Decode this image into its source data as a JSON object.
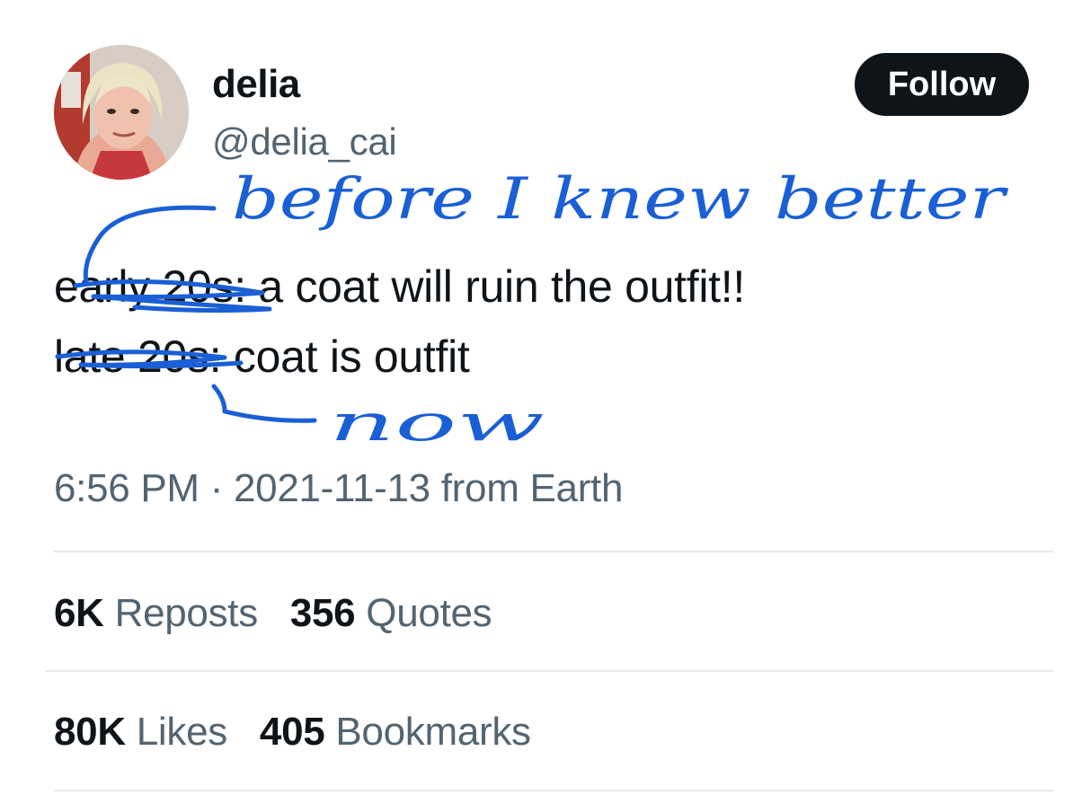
{
  "author": {
    "display_name": "delia",
    "handle": "@delia_cai",
    "avatar_icon": "profile-photo"
  },
  "follow_button": {
    "label": "Follow"
  },
  "tweet": {
    "line1": {
      "prefix": "early 20s",
      "text": ": a coat will ruin the outfit!!"
    },
    "line2": {
      "prefix": "late 20s",
      "text": ": coat is outfit"
    }
  },
  "handwritten_annotations": {
    "above": "before I knew better",
    "below": "now",
    "ink_color": "#1a5fd6"
  },
  "meta": {
    "time": "6:56 PM",
    "separator": "·",
    "date": "2021-11-13",
    "source": "from Earth"
  },
  "stats": {
    "reposts": {
      "count": "6K",
      "label": "Reposts"
    },
    "quotes": {
      "count": "356",
      "label": "Quotes"
    },
    "likes": {
      "count": "80K",
      "label": "Likes"
    },
    "bookmarks": {
      "count": "405",
      "label": "Bookmarks"
    }
  },
  "colors": {
    "primary_text": "#0f1419",
    "secondary_text": "#536471",
    "divider": "#e6e9ec",
    "button_bg": "#0f1419",
    "button_text": "#ffffff"
  }
}
